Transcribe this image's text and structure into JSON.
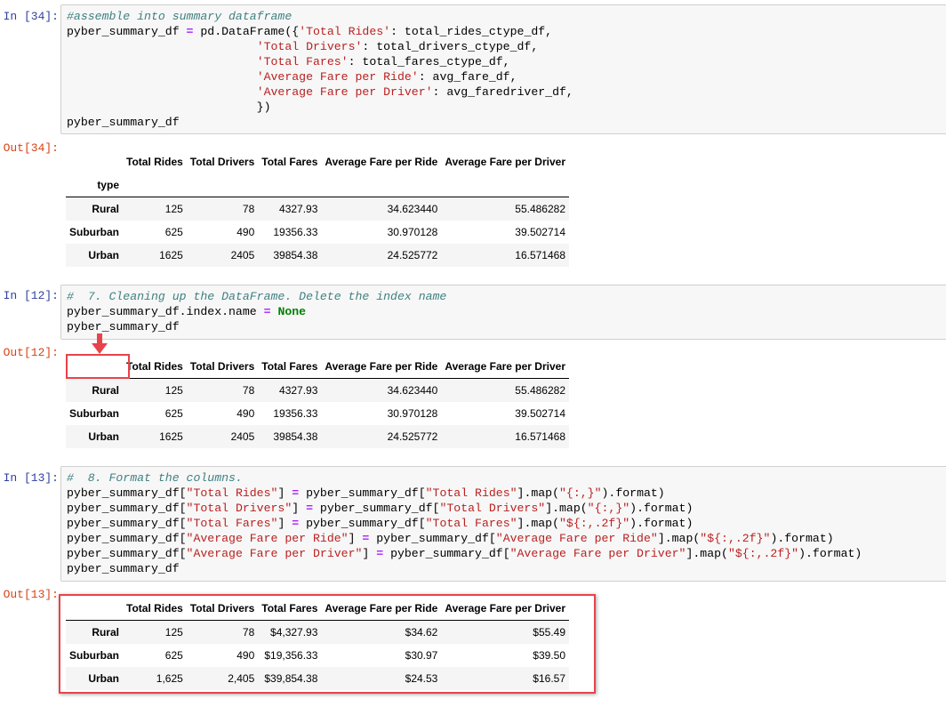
{
  "cells": [
    {
      "in_prompt": "In [34]:",
      "out_prompt": "Out[34]:",
      "code": [
        [
          {
            "t": "#assemble into summary dataframe",
            "c": "comment"
          }
        ],
        [
          {
            "t": "pyber_summary_df "
          },
          {
            "t": "=",
            "c": "op"
          },
          {
            "t": " pd.DataFrame({"
          },
          {
            "t": "'Total Rides'",
            "c": "str"
          },
          {
            "t": ": total_rides_ctype_df,"
          }
        ],
        [
          {
            "t": "                           "
          },
          {
            "t": "'Total Drivers'",
            "c": "str"
          },
          {
            "t": ": total_drivers_ctype_df,"
          }
        ],
        [
          {
            "t": "                           "
          },
          {
            "t": "'Total Fares'",
            "c": "str"
          },
          {
            "t": ": total_fares_ctype_df,"
          }
        ],
        [
          {
            "t": "                           "
          },
          {
            "t": "'Average Fare per Ride'",
            "c": "str"
          },
          {
            "t": ": avg_fare_df,"
          }
        ],
        [
          {
            "t": "                           "
          },
          {
            "t": "'Average Fare per Driver'",
            "c": "str"
          },
          {
            "t": ": avg_faredriver_df,"
          }
        ],
        [
          {
            "t": "                           })"
          }
        ],
        [
          {
            "t": "pyber_summary_df"
          }
        ]
      ],
      "table": {
        "columns": [
          "Total Rides",
          "Total Drivers",
          "Total Fares",
          "Average Fare per Ride",
          "Average Fare per Driver"
        ],
        "index_name": "type",
        "rows": [
          {
            "index": "Rural",
            "values": [
              "125",
              "78",
              "4327.93",
              "34.623440",
              "55.486282"
            ]
          },
          {
            "index": "Suburban",
            "values": [
              "625",
              "490",
              "19356.33",
              "30.970128",
              "39.502714"
            ]
          },
          {
            "index": "Urban",
            "values": [
              "1625",
              "2405",
              "39854.38",
              "24.525772",
              "16.571468"
            ]
          }
        ]
      }
    },
    {
      "in_prompt": "In [12]:",
      "out_prompt": "Out[12]:",
      "code": [
        [
          {
            "t": "#  7. Cleaning up the DataFrame. Delete the index name",
            "c": "comment"
          }
        ],
        [
          {
            "t": "pyber_summary_df.index.name "
          },
          {
            "t": "=",
            "c": "op"
          },
          {
            "t": " "
          },
          {
            "t": "None",
            "c": "kw"
          }
        ],
        [
          {
            "t": "pyber_summary_df"
          }
        ]
      ],
      "table": {
        "columns": [
          "Total Rides",
          "Total Drivers",
          "Total Fares",
          "Average Fare per Ride",
          "Average Fare per Driver"
        ],
        "rows": [
          {
            "index": "Rural",
            "values": [
              "125",
              "78",
              "4327.93",
              "34.623440",
              "55.486282"
            ]
          },
          {
            "index": "Suburban",
            "values": [
              "625",
              "490",
              "19356.33",
              "30.970128",
              "39.502714"
            ]
          },
          {
            "index": "Urban",
            "values": [
              "1625",
              "2405",
              "39854.38",
              "24.525772",
              "16.571468"
            ]
          }
        ]
      }
    },
    {
      "in_prompt": "In [13]:",
      "out_prompt": "Out[13]:",
      "code": [
        [
          {
            "t": "#  8. Format the columns.",
            "c": "comment"
          }
        ],
        [
          {
            "t": "pyber_summary_df["
          },
          {
            "t": "\"Total Rides\"",
            "c": "str"
          },
          {
            "t": "] "
          },
          {
            "t": "=",
            "c": "op"
          },
          {
            "t": " pyber_summary_df["
          },
          {
            "t": "\"Total Rides\"",
            "c": "str"
          },
          {
            "t": "].map("
          },
          {
            "t": "\"{:,}\"",
            "c": "str"
          },
          {
            "t": ").format)"
          }
        ],
        [
          {
            "t": "pyber_summary_df["
          },
          {
            "t": "\"Total Drivers\"",
            "c": "str"
          },
          {
            "t": "] "
          },
          {
            "t": "=",
            "c": "op"
          },
          {
            "t": " pyber_summary_df["
          },
          {
            "t": "\"Total Drivers\"",
            "c": "str"
          },
          {
            "t": "].map("
          },
          {
            "t": "\"{:,}\"",
            "c": "str"
          },
          {
            "t": ").format)"
          }
        ],
        [
          {
            "t": "pyber_summary_df["
          },
          {
            "t": "\"Total Fares\"",
            "c": "str"
          },
          {
            "t": "] "
          },
          {
            "t": "=",
            "c": "op"
          },
          {
            "t": " pyber_summary_df["
          },
          {
            "t": "\"Total Fares\"",
            "c": "str"
          },
          {
            "t": "].map("
          },
          {
            "t": "\"${:,.2f}\"",
            "c": "str"
          },
          {
            "t": ").format)"
          }
        ],
        [
          {
            "t": "pyber_summary_df["
          },
          {
            "t": "\"Average Fare per Ride\"",
            "c": "str"
          },
          {
            "t": "] "
          },
          {
            "t": "=",
            "c": "op"
          },
          {
            "t": " pyber_summary_df["
          },
          {
            "t": "\"Average Fare per Ride\"",
            "c": "str"
          },
          {
            "t": "].map("
          },
          {
            "t": "\"${:,.2f}\"",
            "c": "str"
          },
          {
            "t": ").format)"
          }
        ],
        [
          {
            "t": "pyber_summary_df["
          },
          {
            "t": "\"Average Fare per Driver\"",
            "c": "str"
          },
          {
            "t": "] "
          },
          {
            "t": "=",
            "c": "op"
          },
          {
            "t": " pyber_summary_df["
          },
          {
            "t": "\"Average Fare per Driver\"",
            "c": "str"
          },
          {
            "t": "].map("
          },
          {
            "t": "\"${:,.2f}\"",
            "c": "str"
          },
          {
            "t": ").format)"
          }
        ],
        [
          {
            "t": "pyber_summary_df"
          }
        ]
      ],
      "table": {
        "columns": [
          "Total Rides",
          "Total Drivers",
          "Total Fares",
          "Average Fare per Ride",
          "Average Fare per Driver"
        ],
        "rows": [
          {
            "index": "Rural",
            "values": [
              "125",
              "78",
              "$4,327.93",
              "$34.62",
              "$55.49"
            ]
          },
          {
            "index": "Suburban",
            "values": [
              "625",
              "490",
              "$19,356.33",
              "$30.97",
              "$39.50"
            ]
          },
          {
            "index": "Urban",
            "values": [
              "1,625",
              "2,405",
              "$39,854.38",
              "$24.53",
              "$16.57"
            ]
          }
        ]
      }
    }
  ],
  "colors": {
    "in_prompt": "#303f9f",
    "out_prompt": "#d84315",
    "highlight": "#e8434a",
    "comment": "#408080",
    "string": "#ba2121",
    "keyword": "#008000",
    "operator": "#aa22ff"
  }
}
